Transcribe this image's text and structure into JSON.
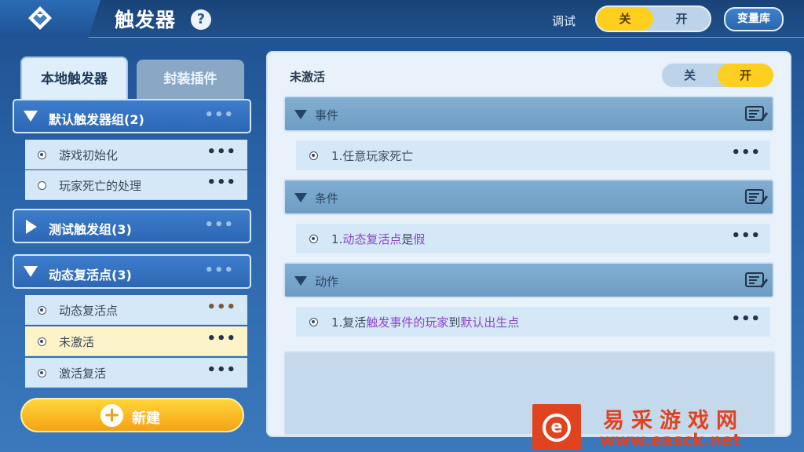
{
  "header": {
    "title": "触发器",
    "help_icon": "question-icon",
    "debug_label": "调试",
    "debug_toggle": {
      "off": "关",
      "on": "开",
      "selected": "off"
    },
    "variables_button": "变量库"
  },
  "left": {
    "tabs": [
      {
        "label": "本地触发器",
        "active": true
      },
      {
        "label": "封装插件",
        "active": false
      }
    ],
    "groups": [
      {
        "label": "默认触发器组(2)",
        "expanded": true,
        "items": [
          {
            "label": "游戏初始化",
            "selected": false,
            "checked": true
          },
          {
            "label": "玩家死亡的处理",
            "selected": false,
            "checked": false
          }
        ]
      },
      {
        "label": "测试触发组(3)",
        "expanded": false,
        "items": []
      },
      {
        "label": "动态复活点(3)",
        "expanded": true,
        "items": [
          {
            "label": "动态复活点",
            "selected": false,
            "checked": true
          },
          {
            "label": "未激活",
            "selected": true,
            "checked": true
          },
          {
            "label": "激活复活",
            "selected": false,
            "checked": true
          }
        ]
      }
    ],
    "more": "•••",
    "new_button": "新建"
  },
  "right": {
    "trigger_name": "未激活",
    "toggle": {
      "off": "关",
      "on": "开",
      "selected": "on"
    },
    "sections": [
      {
        "label": "事件",
        "entry": {
          "prefix": "1.任意玩家死亡",
          "hl1": "",
          "mid": "",
          "hl2": "",
          "suffix": ""
        }
      },
      {
        "label": "条件",
        "entry": {
          "prefix": "1.",
          "hl1": "动态复活点",
          "mid": "是",
          "hl2": "假",
          "suffix": ""
        }
      },
      {
        "label": "动作",
        "entry": {
          "prefix": "1.复活",
          "hl1": "触发事件的玩家",
          "mid": "到",
          "hl2": "默认出生点",
          "suffix": ""
        }
      }
    ]
  },
  "watermark": {
    "name": "易采游戏网",
    "url": "www.easck.net",
    "logo_letter": "e"
  },
  "colors": {
    "accent": "#ffcf1f",
    "highlight": "#8d46c8",
    "watermark": "#e0431f"
  }
}
